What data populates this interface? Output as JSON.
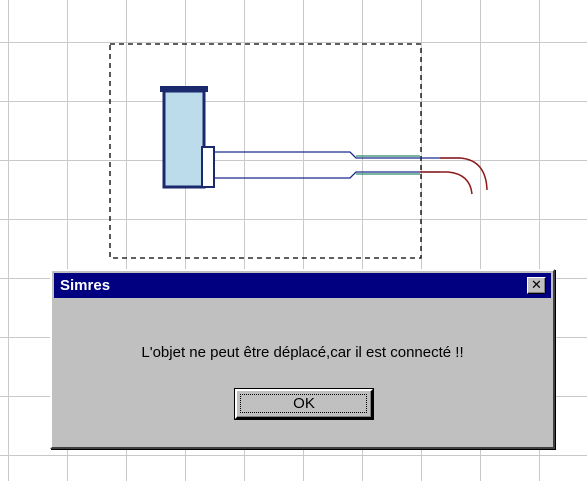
{
  "dialog": {
    "title": "Simres",
    "close_symbol": "✕",
    "message": "L'objet ne peut être déplacé,car il est connecté !!",
    "ok_label": "OK"
  },
  "canvas": {
    "grid_color": "#c9c9c9",
    "selection_style": "dashed",
    "objects": [
      {
        "name": "tank",
        "fill": "#bcdcec",
        "stroke": "#1a2a6c"
      },
      {
        "name": "pipe",
        "colors": [
          "#1a2a8c",
          "#2a8a6a",
          "#8c1a1a"
        ]
      }
    ]
  },
  "colors": {
    "title_bar": "#000080",
    "dialog_face": "#c0c0c0"
  }
}
